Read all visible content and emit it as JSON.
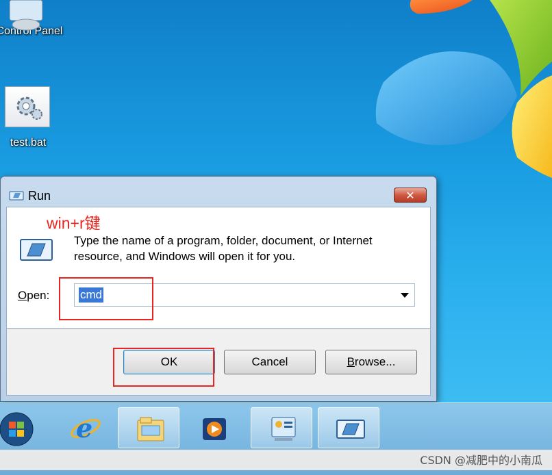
{
  "desktop": {
    "icons": [
      {
        "label": "Control Panel",
        "icon": "control-panel-icon"
      },
      {
        "label": "test.bat",
        "icon": "batch-file-icon"
      }
    ]
  },
  "run_dialog": {
    "title": "Run",
    "annotation": "win+r键",
    "description": "Type the name of a program, folder, document, or Internet resource, and Windows will open it for you.",
    "open_label_mnemonic": "O",
    "open_label_rest": "pen:",
    "open_value": "cmd",
    "buttons": {
      "ok": "OK",
      "cancel": "Cancel",
      "browse_mnemonic": "B",
      "browse_rest": "rowse..."
    },
    "highlight_color": "#e8261f"
  },
  "taskbar": {
    "items": [
      "windows-start-icon",
      "internet-explorer-icon",
      "file-explorer-icon",
      "media-player-icon",
      "control-panel-icon",
      "run-icon"
    ]
  },
  "watermark": "CSDN @减肥中的小南瓜"
}
